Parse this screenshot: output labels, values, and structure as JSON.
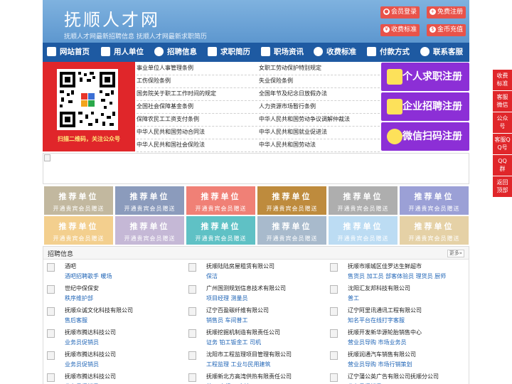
{
  "header": {
    "title": "抚顺人才网",
    "tagline": "抚顺人才网最新招聘信息   抚顺人才网最新求职简历",
    "buttons": [
      {
        "label": "会员登录",
        "icon": "user-icon"
      },
      {
        "label": "免费注册",
        "icon": "register-icon"
      },
      {
        "label": "收费标准",
        "icon": "yen-icon"
      },
      {
        "label": "金币充值",
        "icon": "coin-icon"
      }
    ]
  },
  "nav": {
    "items": [
      {
        "label": "网站首页",
        "icon": "home-icon"
      },
      {
        "label": "用人单位",
        "icon": "building-icon"
      },
      {
        "label": "招聘信息",
        "icon": "recruit-icon"
      },
      {
        "label": "求职简历",
        "icon": "resume-icon"
      },
      {
        "label": "职场资讯",
        "icon": "news-icon"
      },
      {
        "label": "收费标准",
        "icon": "yen-icon"
      },
      {
        "label": "付款方式",
        "icon": "payment-icon"
      },
      {
        "label": "联系客服",
        "icon": "phone-icon"
      }
    ]
  },
  "qr": {
    "caption": "扫描二维码，关注公众号"
  },
  "regulations": [
    "事业单位人事管理条例",
    "女职工劳动保护特别规定",
    "工伤保险条例",
    "失业保险条例",
    "国务院关于职工工作时间的规定",
    "全国年节及纪念日放假办法",
    "全国社会保障基金条例",
    "人力资源市场暂行条例",
    "保障农民工工资支付条例",
    "中华人民共和国劳动争议调解仲裁法",
    "中华人民共和国劳动合同法",
    "中华人民共和国就业促进法",
    "中华人民共和国社会保险法",
    "中华人民共和国劳动法"
  ],
  "register_buttons": [
    {
      "label": "个人求职注册",
      "icon": "person-icon"
    },
    {
      "label": "企业招聘注册",
      "icon": "company-icon"
    },
    {
      "label": "微信扫码注册",
      "icon": "wechat-icon"
    }
  ],
  "recommend": {
    "title": "推荐单位",
    "subtitle": "开通贵宾会员赠送",
    "colors": [
      "#c2b89f",
      "#8b9bbc",
      "#f08076",
      "#be8b3d",
      "#aeaeae",
      "#9ba0d6",
      "#f3cf8e",
      "#c5b8d6",
      "#5fc1c5",
      "#a8bacc",
      "#bcdcf3",
      "#e5d1a6"
    ]
  },
  "jobs": {
    "title": "招聘信息",
    "more": "更多»",
    "items": [
      {
        "company": "酒吧",
        "positions": "酒吧招聘歌手 暖场"
      },
      {
        "company": "抚顺陆陆房屋租赁有限公司",
        "positions": "保洁"
      },
      {
        "company": "抚顺市顺城区佳罗达生鲜超市",
        "positions": "售货员 加工员 部客体验员 理货员 厨师"
      },
      {
        "company": "世纪中保保安",
        "positions": "秩序维护部"
      },
      {
        "company": "广州国测规划信息技术有限公司",
        "positions": "项目经理 测量员"
      },
      {
        "company": "沈阳汇友邦科技有限公司",
        "positions": "普工"
      },
      {
        "company": "抚顺众诚文化科技有限公司",
        "positions": "售后客服"
      },
      {
        "company": "辽宁百盈碳纤维有限公司",
        "positions": "销售员 车间普工"
      },
      {
        "company": "辽宁阿里讯通讯工程有限公司",
        "positions": "知名平台在线打字客服"
      },
      {
        "company": "抚顺市腾达科技公司",
        "positions": "业务员促销员"
      },
      {
        "company": "抚顺挖掘机制造有限责任公司",
        "positions": "证务 铂工钣金工 司机"
      },
      {
        "company": "抚顺开发新华源轮胎销售中心",
        "positions": "营业员导购 市场业务员"
      },
      {
        "company": "抚顺市腾达科技公司",
        "positions": "业务员促销员"
      },
      {
        "company": "沈阳市工程监理项目管理有限公司",
        "positions": "工程监理 工业与民用建筑"
      },
      {
        "company": "抚顺润通汽车销售有限公司",
        "positions": "营业员导购 市场行销策划"
      },
      {
        "company": "抚顺市腾达科技公司",
        "positions": "业务员促销员"
      },
      {
        "company": "抚顺新北方高湾供热有限责任公司",
        "positions": "普工 电焊工 会计"
      },
      {
        "company": "辽宁蒲公英广告有限公司抚顺分公司",
        "positions": "业务员促销员"
      }
    ]
  },
  "float_bar": [
    {
      "label": "收费标准",
      "color": "#e0262a"
    },
    {
      "label": "客服微信",
      "color": "#e0262a"
    },
    {
      "label": "公众号",
      "color": "#e0262a"
    },
    {
      "label": "客服QQ号",
      "color": "#e0262a"
    },
    {
      "label": "QQ群",
      "color": "#e0262a"
    },
    {
      "label": "返回顶部",
      "color": "#e0262a"
    }
  ]
}
